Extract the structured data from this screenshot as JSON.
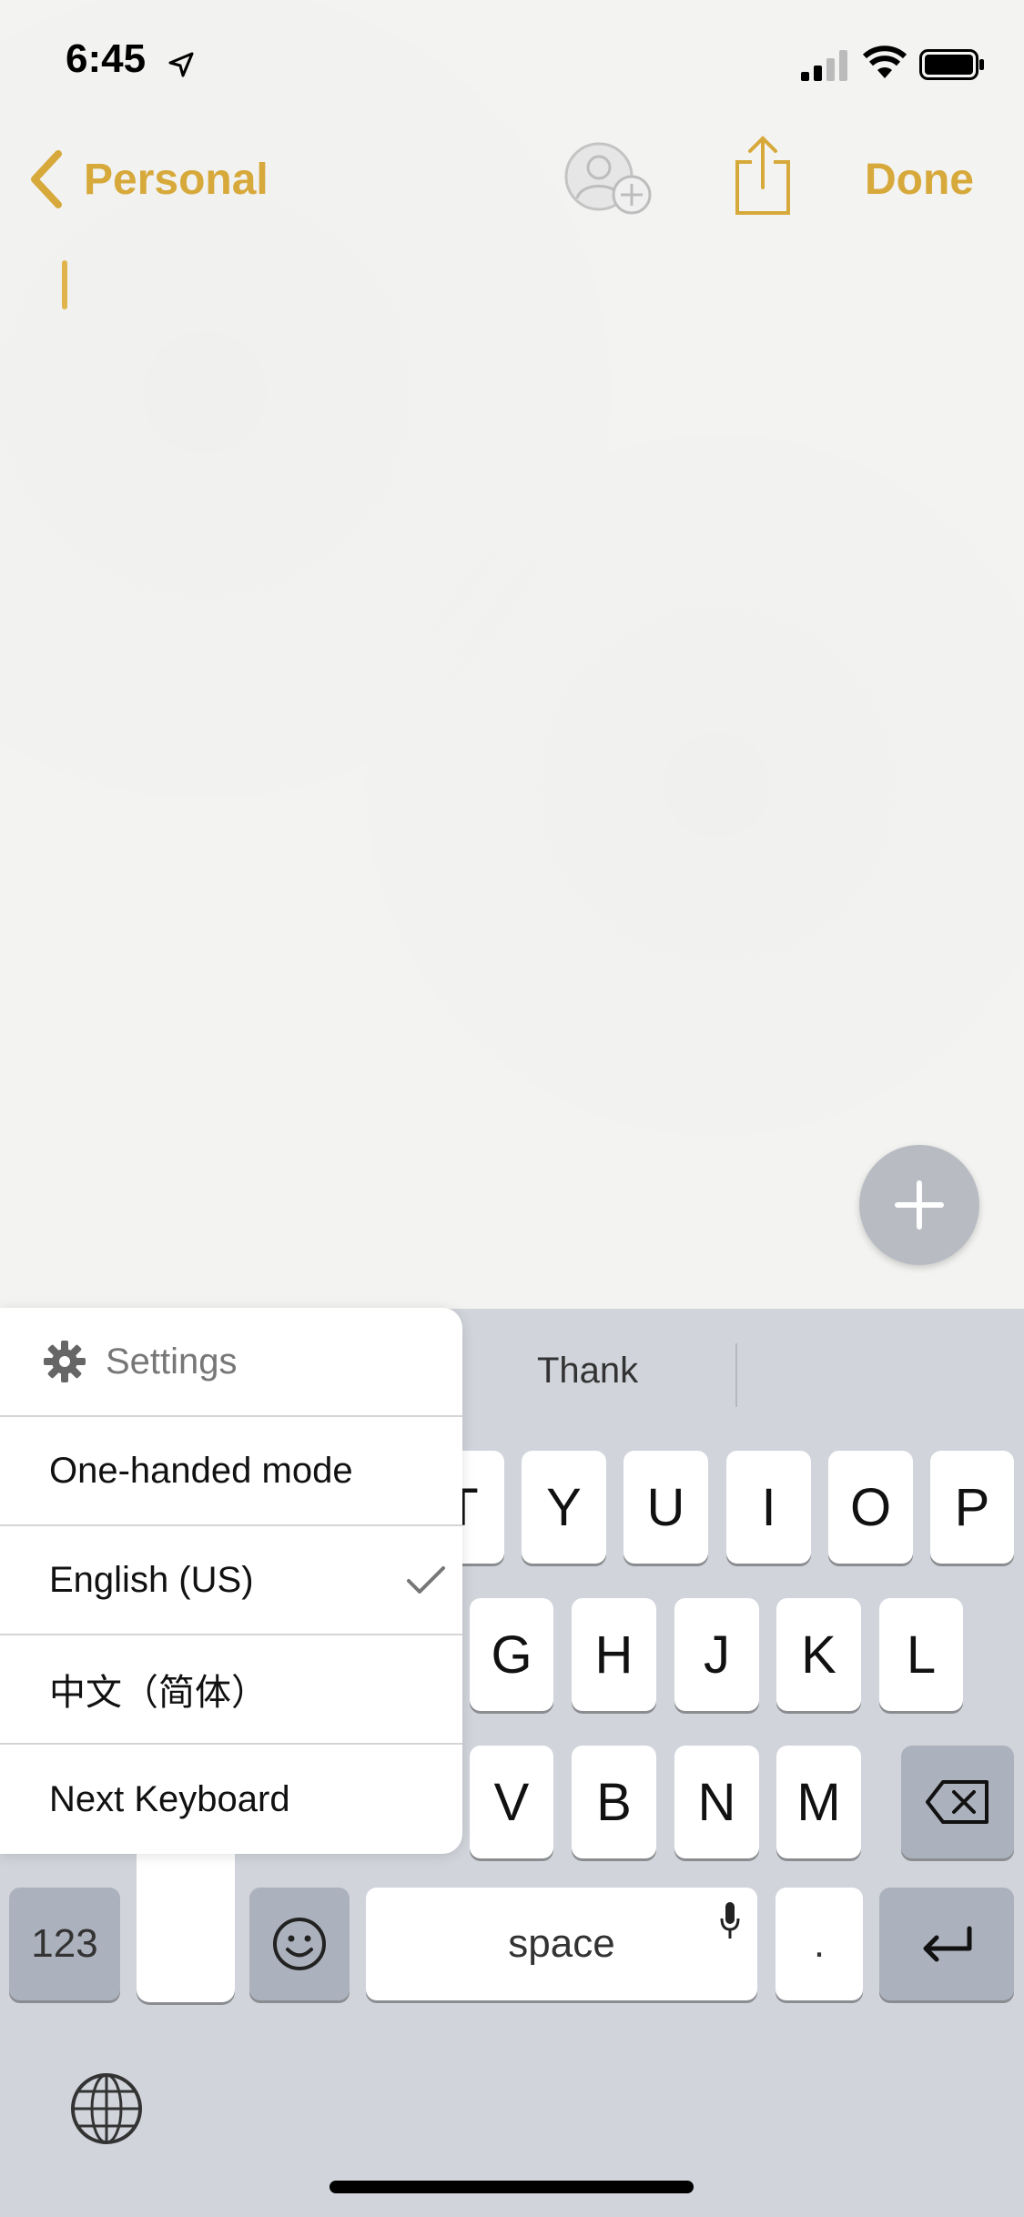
{
  "status_bar": {
    "time": "6:45",
    "icons": [
      "location-arrow-icon",
      "signal-icon",
      "wifi-icon",
      "battery-icon"
    ]
  },
  "nav": {
    "back_label": "Personal",
    "done_label": "Done",
    "icons": [
      "chevron-left-icon",
      "add-person-icon",
      "share-icon"
    ]
  },
  "colors": {
    "accent": "#d7a93b",
    "keyboard_bg": "#d1d4db",
    "key_dark": "#acb2bd"
  },
  "fab": {
    "icon": "plus-icon"
  },
  "predictions": {
    "middle": "Thank"
  },
  "keyboard_popup": {
    "settings_label": "Settings",
    "items": [
      {
        "label": "One-handed mode",
        "checked": false
      },
      {
        "label": "English (US)",
        "checked": true
      },
      {
        "label": "中文（简体）",
        "checked": false
      },
      {
        "label": "Next Keyboard",
        "checked": false
      }
    ]
  },
  "keyboard": {
    "row1": [
      "T",
      "Y",
      "U",
      "I",
      "O",
      "P"
    ],
    "row2": [
      "G",
      "H",
      "J",
      "K",
      "L"
    ],
    "row3": [
      "V",
      "B",
      "N",
      "M"
    ],
    "numbers_label": "123",
    "space_label": "space",
    "period_label": "."
  }
}
